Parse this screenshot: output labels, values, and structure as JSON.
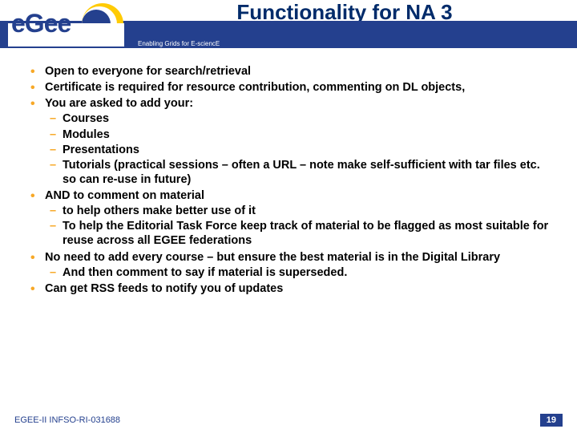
{
  "header": {
    "title": "Functionality for NA 3",
    "tagline": "Enabling Grids for E-sciencE"
  },
  "bullets": {
    "b1": "Open to everyone for search/retrieval",
    "b2": "Certificate is required for resource contribution, commenting on DL objects,",
    "b3": "You are asked to add your:",
    "b3s1": "Courses",
    "b3s2": "Modules",
    "b3s3": "Presentations",
    "b3s4": "Tutorials  (practical sessions – often a URL – note make self-sufficient with tar files etc. so can re-use in future)",
    "b4": "AND to comment on material",
    "b4s1": "to help others make better use of it",
    "b4s2": "To help the Editorial Task Force keep track of material to be flagged as most suitable for reuse across all EGEE federations",
    "b5": "No need to add every course – but ensure the best material is in the Digital Library",
    "b5s1": "And then comment to say if material is superseded.",
    "b6": "Can get RSS feeds to notify you of updates"
  },
  "footer": {
    "left": "EGEE-II INFSO-RI-031688",
    "right": "19"
  },
  "colors": {
    "blue": "#24408e",
    "orange": "#f7a827",
    "yellow": "#ffcb05"
  }
}
